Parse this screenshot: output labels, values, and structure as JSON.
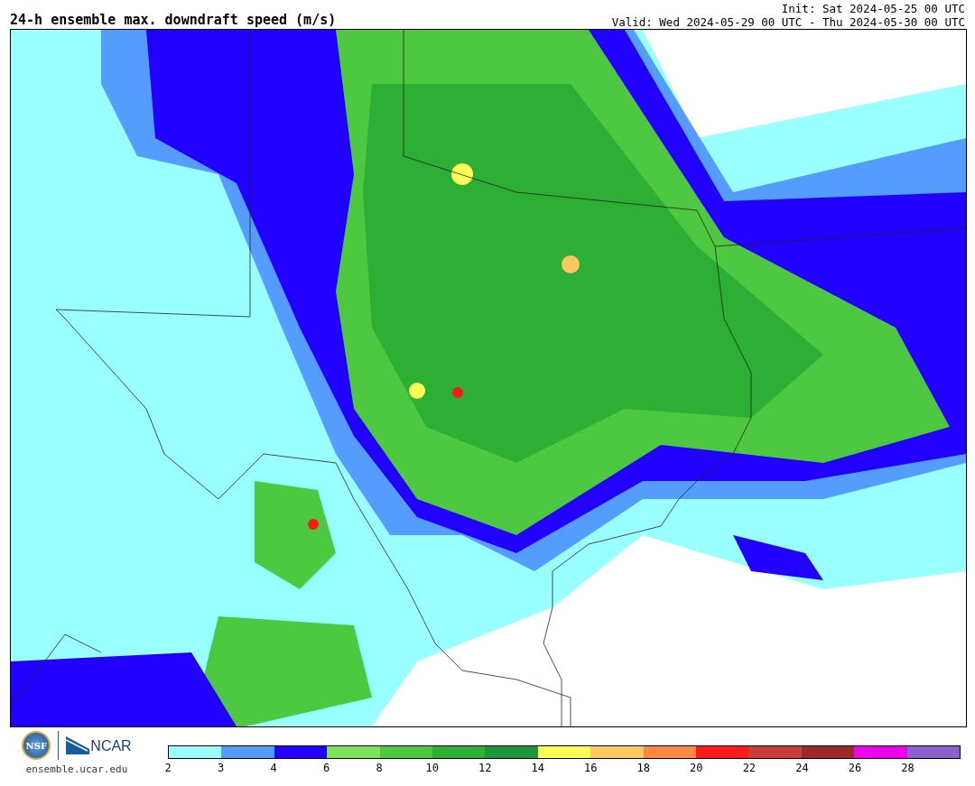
{
  "header": {
    "title": "24-h ensemble max. downdraft speed (m/s)",
    "init": "Init: Sat 2024-05-25 00 UTC",
    "valid": "Valid: Wed 2024-05-29 00 UTC - Thu 2024-05-30 00 UTC"
  },
  "footer": {
    "nsf_logo": "NSF",
    "ncar_logo": "NCAR",
    "site": "ensemble.ucar.edu"
  },
  "colorbar": {
    "segments": [
      {
        "color": "#99ffff"
      },
      {
        "color": "#559cff"
      },
      {
        "color": "#2200ff"
      },
      {
        "color": "#7ee15a"
      },
      {
        "color": "#4dc840"
      },
      {
        "color": "#2daf35"
      },
      {
        "color": "#1f963b"
      },
      {
        "color": "#ffff55"
      },
      {
        "color": "#ffc860"
      },
      {
        "color": "#ff8844"
      },
      {
        "color": "#ff1a1a"
      },
      {
        "color": "#c83c3c"
      },
      {
        "color": "#9c2a2a"
      },
      {
        "color": "#ee00ee"
      },
      {
        "color": "#8a60cc"
      }
    ],
    "ticks": [
      "2",
      "3",
      "4",
      "6",
      "8",
      "10",
      "12",
      "14",
      "16",
      "18",
      "20",
      "22",
      "24",
      "26",
      "28"
    ]
  }
}
